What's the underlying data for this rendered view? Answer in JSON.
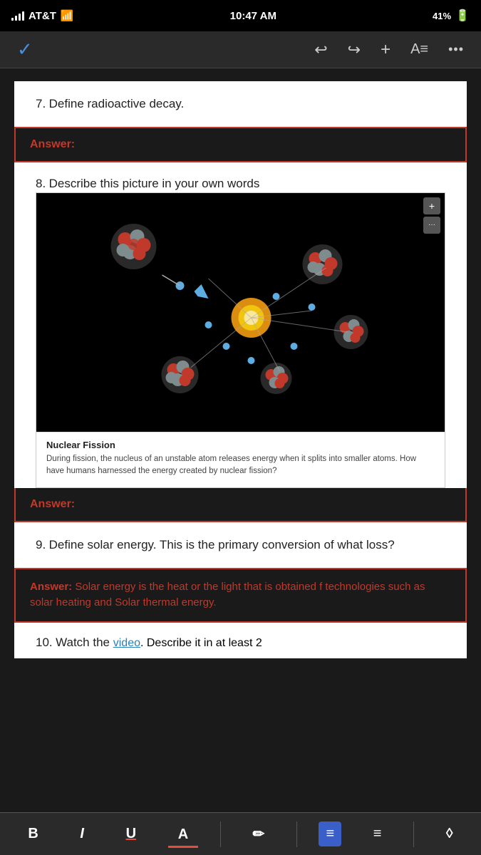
{
  "statusBar": {
    "carrier": "AT&T",
    "time": "10:47 AM",
    "battery": "41%"
  },
  "toolbar": {
    "checkIcon": "✓",
    "undoIcon": "↩",
    "redoIcon": "↪",
    "addIcon": "+",
    "fontIcon": "A≡",
    "moreIcon": "•••"
  },
  "questions": {
    "q7": {
      "number": "7.",
      "text": "Define radioactive decay."
    },
    "q7answer": {
      "label": "Answer:"
    },
    "q8": {
      "number": "8.",
      "text": "Describe this picture in your own words"
    },
    "q8answer": {
      "label": "Answer:"
    },
    "imageCaption": {
      "title": "Nuclear Fission",
      "text": "During fission, the nucleus of an unstable atom releases energy when it splits into smaller atoms. How have humans harnessed the energy created by nuclear fission?"
    },
    "q9": {
      "number": "9.",
      "text": "Define solar energy. This is the primary conversion of what loss?"
    },
    "q9answer": {
      "prefix": "Answer: ",
      "text": "Solar energy is the heat or the light that is obtained f technologies such as solar heating and Solar thermal energy."
    },
    "q10": {
      "number": "10.",
      "text": "Watch the video. Describe it in at least 2"
    }
  },
  "imageControls": {
    "plusBtn": "+",
    "dotsBtn": "···"
  },
  "bottomToolbar": {
    "boldLabel": "B",
    "italicLabel": "I",
    "underlineLabel": "U",
    "colorLabel": "A",
    "pencilLabel": "✏",
    "listIcon": "≡",
    "listIcon2": "≡",
    "eraserIcon": "◊"
  }
}
